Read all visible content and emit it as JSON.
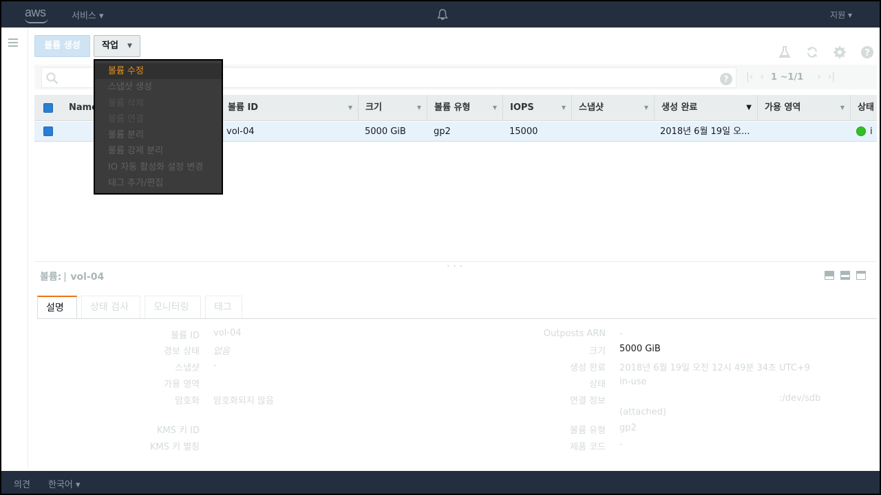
{
  "topnav": {
    "logo": "aws",
    "services": "서비스",
    "support": "지원"
  },
  "toolbar": {
    "create_label": "볼륨 생성",
    "actions_label": "작업"
  },
  "actions_menu": [
    {
      "label": "볼륨 수정",
      "state": "highlighted"
    },
    {
      "label": "스냅샷 생성",
      "state": "normal"
    },
    {
      "label": "볼륨 삭제",
      "state": "disabled"
    },
    {
      "label": "볼륨 연결",
      "state": "disabled"
    },
    {
      "label": "볼륨 분리",
      "state": "normal"
    },
    {
      "label": "볼륨 강제 분리",
      "state": "normal"
    },
    {
      "label": "IO 자동 활성화 설정 변경",
      "state": "normal"
    },
    {
      "label": "태그 추가/편집",
      "state": "normal"
    }
  ],
  "search": {
    "placeholder": "",
    "pager": "1 ~1/1"
  },
  "table": {
    "columns": [
      "Name",
      "볼륨 ID",
      "크기",
      "볼륨 유형",
      "IOPS",
      "스냅샷",
      "생성 완료",
      "가용 영역",
      "상태"
    ],
    "rows": [
      {
        "name": "",
        "volume_id": "vol-04",
        "size": "5000 GiB",
        "type": "gp2",
        "iops": "15000",
        "snapshot": "",
        "created": "2018년 6월 19일 오...",
        "az": "",
        "status": "i"
      }
    ]
  },
  "details": {
    "title_prefix": "볼륨:",
    "title_volume": "vol-04",
    "tabs": [
      "설명",
      "상태 검사",
      "모니터링",
      "태그"
    ],
    "left": [
      {
        "label": "볼륨 ID",
        "value": "vol-04"
      },
      {
        "label": "경보 상태",
        "value": "없음"
      },
      {
        "label": "스냅샷",
        "value": "-"
      },
      {
        "label": "가용 영역",
        "value": ""
      },
      {
        "label": "암호화",
        "value": "암호화되지 않음"
      },
      {
        "label": "KMS 키 ID",
        "value": ""
      },
      {
        "label": "KMS 키 별칭",
        "value": ""
      }
    ],
    "right": [
      {
        "label": "Outposts ARN",
        "value": "-"
      },
      {
        "label": "크기",
        "value": "5000 GiB"
      },
      {
        "label": "생성 완료",
        "value": "2018년 6월 19일 오전 12시 49분 34초 UTC+9"
      },
      {
        "label": "상태",
        "value": "in-use"
      },
      {
        "label": "연결 정보",
        "value": ":/dev/sdb",
        "value2": "(attached)"
      },
      {
        "label": "볼륨 유형",
        "value": "gp2"
      },
      {
        "label": "제품 코드",
        "value": "-"
      }
    ]
  },
  "footer": {
    "feedback": "의견",
    "language": "한국어"
  },
  "colors": {
    "nav_bg": "#232f3e",
    "accent": "#ec7211",
    "menu_highlight": "#e8901d",
    "status_green": "#32c124",
    "selection": "#2a7fd4"
  }
}
